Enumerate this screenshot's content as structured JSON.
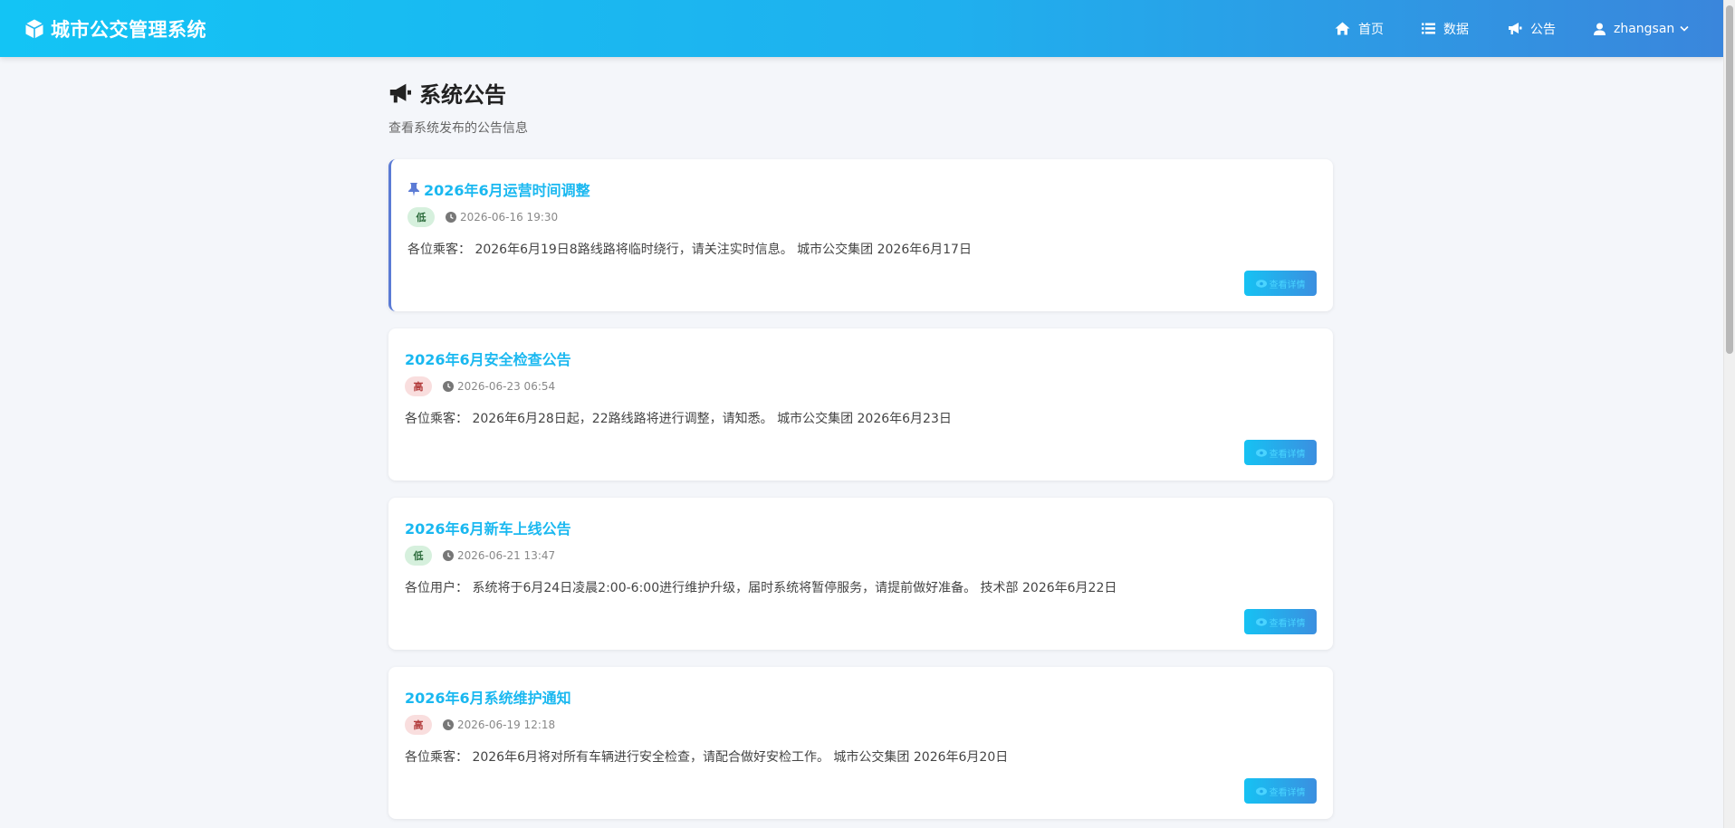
{
  "app": {
    "title": "城市公交管理系统"
  },
  "nav": {
    "home": "首页",
    "data": "数据",
    "notice": "公告",
    "user": "zhangsan"
  },
  "page": {
    "title": "系统公告",
    "subtitle": "查看系统发布的公告信息"
  },
  "notices": [
    {
      "title": "2026年6月运营时间调整",
      "pinned": true,
      "priority": "低",
      "time": "2026-06-16 19:30",
      "content": "各位乘客： 2026年6月19日8路线路将临时绕行，请关注实时信息。 城市公交集团 2026年6月17日",
      "button": "查看详情"
    },
    {
      "title": "2026年6月安全检查公告",
      "pinned": false,
      "priority": "高",
      "time": "2026-06-23 06:54",
      "content": "各位乘客： 2026年6月28日起，22路线路将进行调整，请知悉。 城市公交集团 2026年6月23日",
      "button": "查看详情"
    },
    {
      "title": "2026年6月新车上线公告",
      "pinned": false,
      "priority": "低",
      "time": "2026-06-21 13:47",
      "content": "各位用户： 系统将于6月24日凌晨2:00-6:00进行维护升级，届时系统将暂停服务，请提前做好准备。 技术部 2026年6月22日",
      "button": "查看详情"
    },
    {
      "title": "2026年6月系统维护通知",
      "pinned": false,
      "priority": "高",
      "time": "2026-06-19 12:18",
      "content": "各位乘客： 2026年6月将对所有车辆进行安全检查，请配合做好安检工作。 城市公交集团 2026年6月20日",
      "button": "查看详情"
    }
  ],
  "colors": {
    "accent": "#1ab8f0",
    "header_start": "#13c4f5",
    "header_end": "#3a86dc",
    "badge_low": "#d6f0dd",
    "badge_high": "#f9dede"
  },
  "icons": {
    "brand": "cube-icon",
    "home": "home-icon",
    "data": "list-icon",
    "notice": "megaphone-icon",
    "user": "user-icon",
    "pin": "pin-icon",
    "clock": "clock-icon",
    "eye": "eye-icon"
  }
}
